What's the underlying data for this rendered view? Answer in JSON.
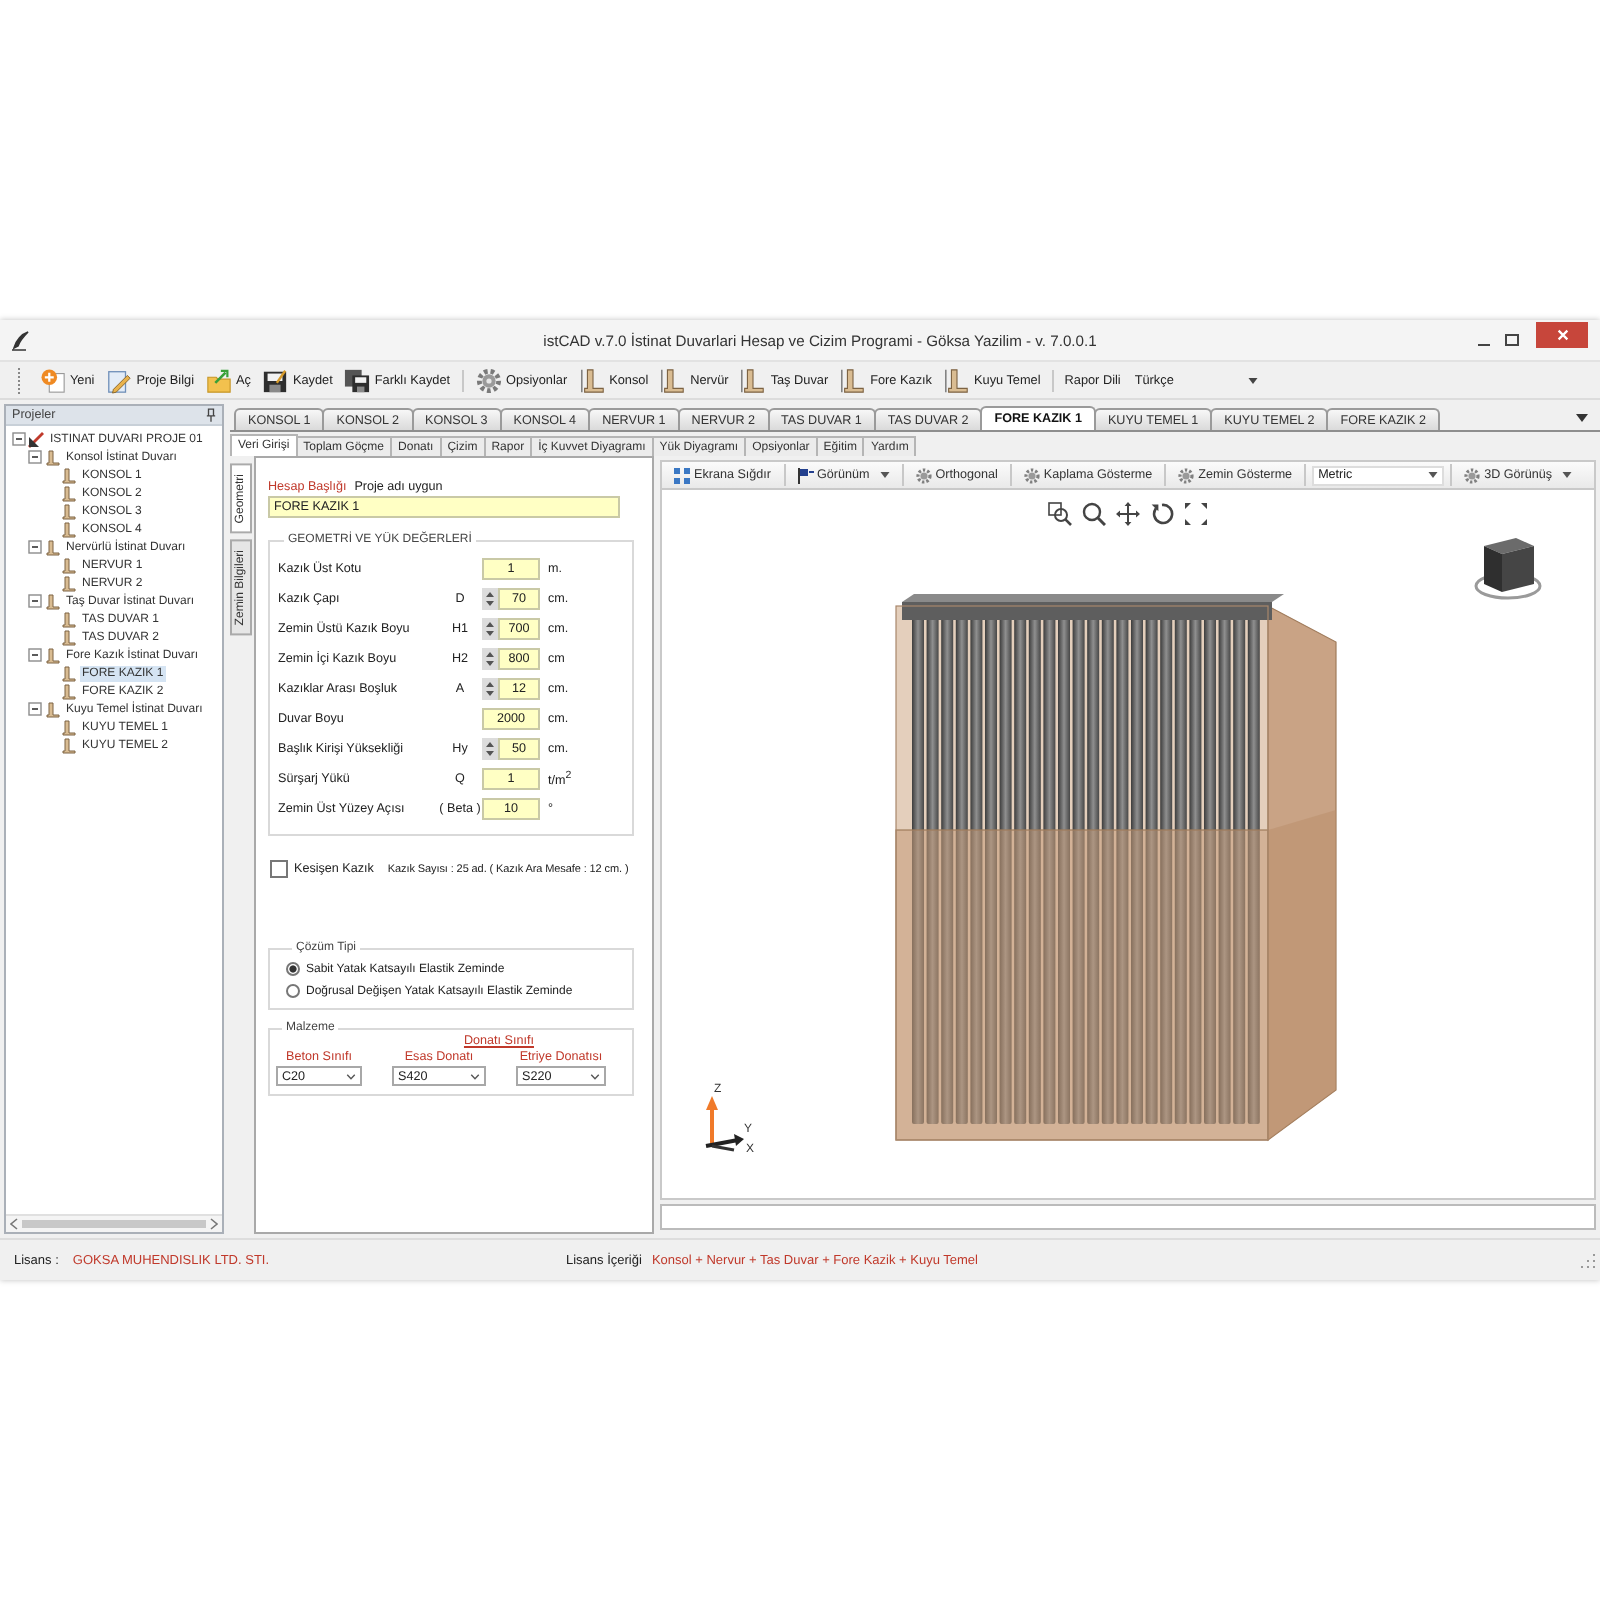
{
  "window": {
    "title": "istCAD v.7.0 İstinat Duvarlari Hesap ve Cizim Programi - Göksa Yazilim - v. 7.0.0.1"
  },
  "toolbar": {
    "groups": [
      {
        "items": [
          {
            "label": "Yeni"
          },
          {
            "label": "Proje Bilgi"
          },
          {
            "label": "Aç"
          },
          {
            "label": "Kaydet"
          },
          {
            "label": "Farklı Kaydet"
          }
        ]
      },
      {
        "items": [
          {
            "label": "Opsiyonlar"
          },
          {
            "label": "Konsol"
          },
          {
            "label": "Nervür"
          },
          {
            "label": "Taş Duvar"
          },
          {
            "label": "Fore Kazık"
          },
          {
            "label": "Kuyu Temel"
          }
        ]
      }
    ],
    "language_label": "Rapor Dili",
    "language": "Türkçe"
  },
  "projects_panel": {
    "title": "Projeler",
    "tree": [
      {
        "label": "ISTINAT DUVARI PROJE 01",
        "expanded": true,
        "selected": false,
        "children": [
          {
            "label": "Konsol İstinat Duvarı",
            "expanded": true,
            "selected": false,
            "children": [
              {
                "label": "KONSOL 1",
                "selected": false
              },
              {
                "label": "KONSOL 2",
                "selected": false
              },
              {
                "label": "KONSOL 3",
                "selected": false
              },
              {
                "label": "KONSOL 4",
                "selected": false
              }
            ]
          },
          {
            "label": "Nervürlü İstinat Duvarı",
            "expanded": true,
            "selected": false,
            "children": [
              {
                "label": "NERVUR 1",
                "selected": false
              },
              {
                "label": "NERVUR 2",
                "selected": false
              }
            ]
          },
          {
            "label": "Taş Duvar İstinat Duvarı",
            "expanded": true,
            "selected": false,
            "children": [
              {
                "label": "TAS DUVAR 1",
                "selected": false
              },
              {
                "label": "TAS DUVAR 2",
                "selected": false
              }
            ]
          },
          {
            "label": "Fore Kazık İstinat Duvarı",
            "expanded": true,
            "selected": false,
            "children": [
              {
                "label": "FORE KAZIK 1",
                "selected": true
              },
              {
                "label": "FORE KAZIK 2",
                "selected": false
              }
            ]
          },
          {
            "label": "Kuyu Temel İstinat Duvarı",
            "expanded": true,
            "selected": false,
            "children": [
              {
                "label": "KUYU TEMEL 1",
                "selected": false
              },
              {
                "label": "KUYU TEMEL 2",
                "selected": false
              }
            ]
          }
        ]
      }
    ]
  },
  "project_tabs": [
    {
      "label": "KONSOL 1",
      "selected": false
    },
    {
      "label": "KONSOL 2",
      "selected": false
    },
    {
      "label": "KONSOL 3",
      "selected": false
    },
    {
      "label": "KONSOL 4",
      "selected": false
    },
    {
      "label": "NERVUR 1",
      "selected": false
    },
    {
      "label": "NERVUR 2",
      "selected": false
    },
    {
      "label": "TAS DUVAR 1",
      "selected": false
    },
    {
      "label": "TAS DUVAR 2",
      "selected": false
    },
    {
      "label": "FORE KAZIK 1",
      "selected": true
    },
    {
      "label": "KUYU TEMEL 1",
      "selected": false
    },
    {
      "label": "KUYU TEMEL 2",
      "selected": false
    },
    {
      "label": "FORE KAZIK 2",
      "selected": false
    }
  ],
  "view_tabs": [
    {
      "label": "Veri Girişi",
      "selected": true
    },
    {
      "label": "Toplam Göçme",
      "selected": false
    },
    {
      "label": "Donatı",
      "selected": false
    },
    {
      "label": "Çizim",
      "selected": false
    },
    {
      "label": "Rapor",
      "selected": false
    },
    {
      "label": "İç Kuvvet Diyagramı",
      "selected": false
    },
    {
      "label": "Yük Diyagramı",
      "selected": false
    },
    {
      "label": "Opsiyonlar",
      "selected": false
    },
    {
      "label": "Eğitim",
      "selected": false
    },
    {
      "label": "Yardım",
      "selected": false
    }
  ],
  "data_form": {
    "side_tabs": [
      {
        "label": "Geometri",
        "selected": true
      },
      {
        "label": "Zemin Bilgileri",
        "selected": false
      }
    ],
    "title_label": "Hesap Başlığı",
    "title_hint": "Proje adı uygun",
    "title_value": "FORE KAZIK 1",
    "geometry": {
      "legend": "GEOMETRİ VE YÜK DEĞERLERİ",
      "rows": [
        {
          "label": "Kazık Üst Kotu",
          "kind": "plain",
          "value": "1",
          "unit": "m."
        },
        {
          "label": "Kazık Çapı",
          "symbol": "D",
          "kind": "spinner",
          "value": "70",
          "unit": "cm."
        },
        {
          "label": "Zemin Üstü Kazık Boyu",
          "symbol": "H1",
          "kind": "spinner",
          "value": "700",
          "unit": "cm."
        },
        {
          "label": "Zemin İçi Kazık Boyu",
          "symbol": "H2",
          "kind": "spinner",
          "value": "800",
          "unit": "cm"
        },
        {
          "label": "Kazıklar Arası Boşluk",
          "symbol": "A",
          "kind": "spinner",
          "value": "12",
          "unit": "cm."
        },
        {
          "label": "Duvar Boyu",
          "kind": "plain",
          "value": "2000",
          "unit": "cm."
        },
        {
          "label": "Başlık Kirişi Yüksekliği",
          "symbol": "Hy",
          "kind": "spinner",
          "value": "50",
          "unit": "cm."
        },
        {
          "label": "Sürşarj Yükü",
          "symbol": "Q",
          "kind": "plain",
          "value": "1",
          "unit": "t/m$^{2}$"
        },
        {
          "label": "Zemin Üst Yüzey Açısı",
          "symbol": "( Beta )",
          "kind": "plain",
          "value": "10",
          "unit": "°"
        }
      ]
    },
    "pile_option": {
      "label": "Kesişen Kazık",
      "checked": false
    },
    "pile_summary": "Kazık Sayısı : 25 ad. ( Kazık Ara Mesafe : 12 cm. )",
    "solution": {
      "legend": "Çözüm Tipi",
      "options": [
        {
          "label": "Sabit Yatak Katsayılı Elastik Zeminde",
          "selected": true
        },
        {
          "label": "Doğrusal Değişen Yatak Katsayılı Elastik Zeminde",
          "selected": false
        }
      ]
    },
    "material": {
      "legend": "Malzeme",
      "rebar_heading": "Donatı Sınıfı",
      "fields": [
        {
          "label": "Beton Sınıfı",
          "value": "C20"
        },
        {
          "label": "Esas Donatı",
          "value": "S420"
        },
        {
          "label": "Etriye Donatısı",
          "value": "S220"
        }
      ]
    }
  },
  "viewer": {
    "toolbar": [
      {
        "label": "Ekrana Sığdır",
        "kind": "button"
      },
      {
        "label": "Görünüm",
        "kind": "menu"
      },
      {
        "label": "Orthogonal",
        "kind": "button"
      },
      {
        "label": "Kaplama Gösterme",
        "kind": "button"
      },
      {
        "label": "Zemin Gösterme",
        "kind": "button"
      },
      {
        "value": "Metric",
        "kind": "select"
      },
      {
        "label": "3D Görünüş",
        "kind": "menu"
      }
    ],
    "axis_labels": [
      "Z",
      "Y",
      "X"
    ]
  },
  "status_bar": {
    "license_label": "Lisans :",
    "license_value": "GOKSA MUHENDISLIK LTD. STI.",
    "content_label": "Lisans İçeriği",
    "content_value": "Konsol + Nervur + Tas Duvar + Fore Kazik + Kuyu Temel"
  }
}
